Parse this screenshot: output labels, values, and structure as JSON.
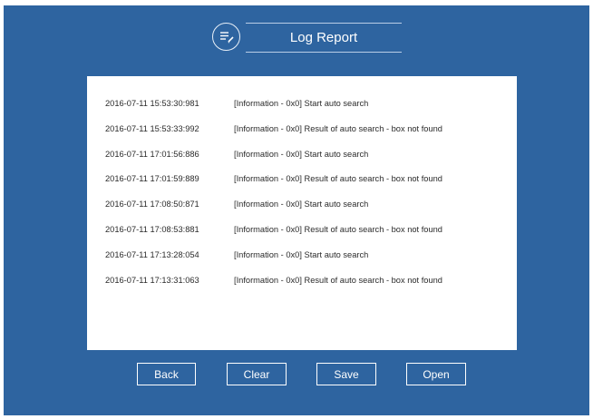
{
  "header": {
    "title": "Log Report",
    "icon": "log-list-icon"
  },
  "log": {
    "entries": [
      {
        "timestamp": "2016-07-11 15:53:30:981",
        "message": "[Information - 0x0] Start auto search"
      },
      {
        "timestamp": "2016-07-11 15:53:33:992",
        "message": "[Information - 0x0] Result of auto search - box not found"
      },
      {
        "timestamp": "2016-07-11 17:01:56:886",
        "message": "[Information - 0x0] Start auto search"
      },
      {
        "timestamp": "2016-07-11 17:01:59:889",
        "message": "[Information - 0x0] Result of auto search - box not found"
      },
      {
        "timestamp": "2016-07-11 17:08:50:871",
        "message": "[Information - 0x0] Start auto search"
      },
      {
        "timestamp": "2016-07-11 17:08:53:881",
        "message": "[Information - 0x0] Result of auto search - box not found"
      },
      {
        "timestamp": "2016-07-11 17:13:28:054",
        "message": "[Information - 0x0] Start auto search"
      },
      {
        "timestamp": "2016-07-11 17:13:31:063",
        "message": "[Information - 0x0] Result of auto search - box not found"
      }
    ]
  },
  "buttons": {
    "back": "Back",
    "clear": "Clear",
    "save": "Save",
    "open": "Open"
  },
  "colors": {
    "background": "#2e64a0",
    "panel": "#ffffff",
    "text_light": "#ffffff",
    "text_dark": "#2b2b2b"
  }
}
